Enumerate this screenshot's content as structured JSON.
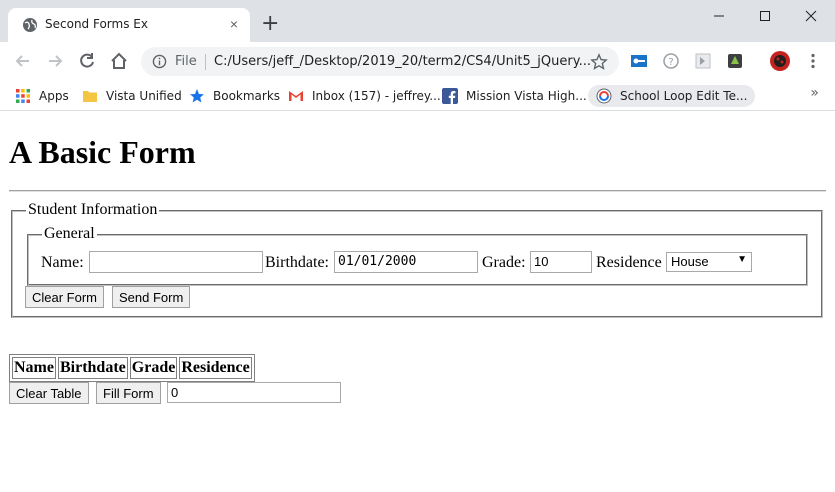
{
  "browser": {
    "tab_title": "Second Forms Ex",
    "tab_close_glyph": "×",
    "new_tab_glyph": "+",
    "url_scheme": "File",
    "url": "C:/Users/jeff_/Desktop/2019_20/term2/CS4/Unit5_jQuery...",
    "bookmarks": [
      {
        "label": "Apps",
        "icon": "apps-grid-icon"
      },
      {
        "label": "Vista Unified",
        "icon": "folder-icon"
      },
      {
        "label": "Bookmarks",
        "icon": "star-icon"
      },
      {
        "label": "Inbox (157) - jeffrey...",
        "icon": "gmail-icon"
      },
      {
        "label": "Mission Vista High...",
        "icon": "facebook-icon"
      },
      {
        "label": "School Loop Edit Te...",
        "icon": "schoolloop-icon"
      }
    ],
    "bookmarks_overflow": "»"
  },
  "page": {
    "title": "A Basic Form",
    "fieldset_legend": "Student Information",
    "inner_legend": "General",
    "labels": {
      "name": "Name:",
      "birthdate": "Birthdate:",
      "grade": "Grade:",
      "residence": "Residence"
    },
    "inputs": {
      "name": "",
      "birthdate": "01/01/2000",
      "grade": "10",
      "residence": "House"
    },
    "buttons": {
      "clear_form": "Clear Form",
      "send_form": "Send Form",
      "clear_table": "Clear Table",
      "fill_form": "Fill Form"
    },
    "table_headers": [
      "Name",
      "Birthdate",
      "Grade",
      "Residence"
    ],
    "counter_value": "0"
  },
  "colors": {
    "titlebar": "#dee1e6",
    "omnibox": "#f1f3f4"
  }
}
